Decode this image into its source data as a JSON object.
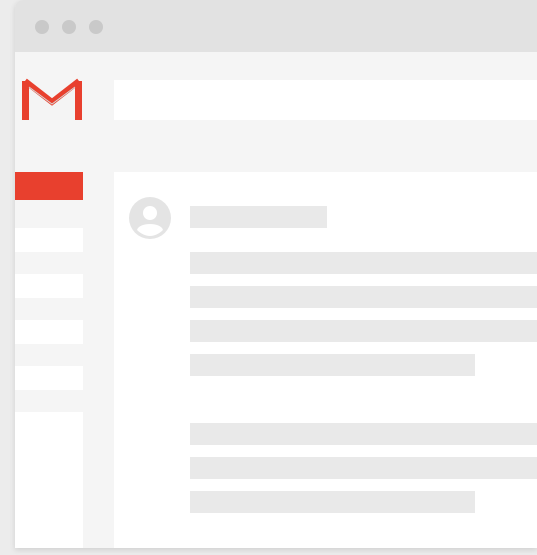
{
  "window": {
    "controls": [
      "close",
      "minimize",
      "maximize"
    ]
  },
  "app": {
    "logo_icon": "gmail-m-logo-icon",
    "accent_color": "#e8402e"
  },
  "sidebar": {
    "items": [
      {
        "state": "active"
      },
      {
        "state": "inactive"
      },
      {
        "state": "inactive"
      },
      {
        "state": "inactive"
      },
      {
        "state": "inactive"
      }
    ]
  },
  "message": {
    "avatar_icon": "account-circle-icon",
    "placeholder_lines": 8
  },
  "colors": {
    "titlebar": "#e2e2e2",
    "background": "#f5f5f5",
    "surface": "#ffffff",
    "placeholder": "#e9e9e9"
  }
}
